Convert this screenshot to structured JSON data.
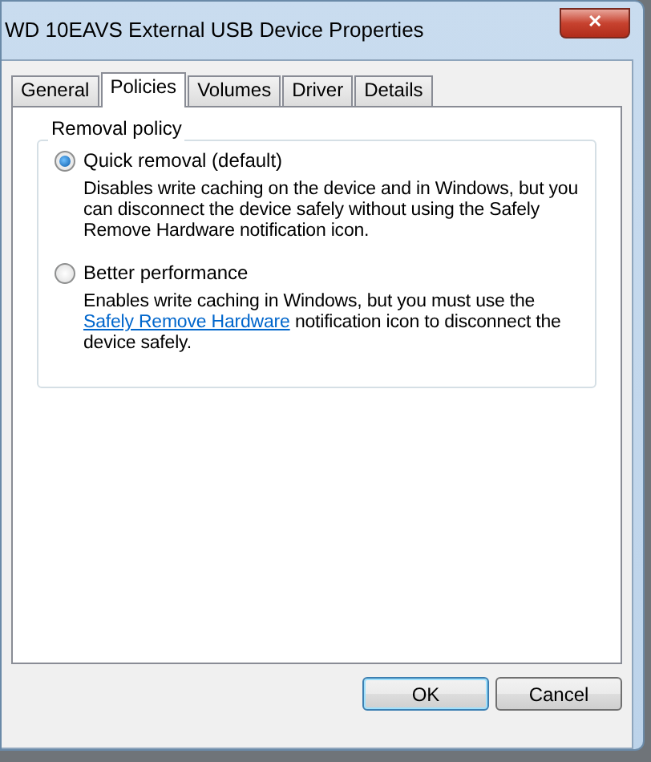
{
  "window": {
    "title": "WD 10EAVS External USB Device Properties",
    "close": "✕"
  },
  "tabs": [
    {
      "label": "General",
      "selected": false
    },
    {
      "label": "Policies",
      "selected": true
    },
    {
      "label": "Volumes",
      "selected": false
    },
    {
      "label": "Driver",
      "selected": false
    },
    {
      "label": "Details",
      "selected": false
    }
  ],
  "group": {
    "title": "Removal policy",
    "options": [
      {
        "label": "Quick removal (default)",
        "selected": true,
        "description": [
          {
            "kind": "text",
            "text": "Disables write caching on the device and in Windows, but you can disconnect the device safely without using the Safely Remove Hardware notification icon."
          }
        ]
      },
      {
        "label": "Better performance",
        "selected": false,
        "description": [
          {
            "kind": "text",
            "text": "Enables write caching in Windows, but you must use the"
          },
          {
            "kind": "link",
            "text": "Safely Remove Hardware"
          },
          {
            "kind": "text",
            "text": "notification icon to disconnect the device safely."
          }
        ]
      }
    ]
  },
  "buttons": [
    {
      "label": "OK",
      "default": true
    },
    {
      "label": "Cancel",
      "default": false
    }
  ]
}
